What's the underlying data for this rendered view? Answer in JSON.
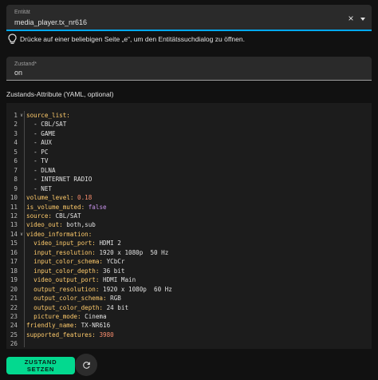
{
  "entity_field": {
    "label": "Entität",
    "value": "media_player.tx_nr616",
    "clear_glyph": "×"
  },
  "hint": {
    "icon": "lightbulb-icon",
    "text": "Drücke auf einer beliebigen Seite „e“, um den Entitätssuchdialog zu öffnen."
  },
  "state_field": {
    "label": "Zustand*",
    "value": "on"
  },
  "attributes_label": "Zustands-Attribute (YAML, optional)",
  "editor": {
    "lines": [
      {
        "n": "1",
        "fold": true,
        "tokens": [
          {
            "t": "source_list:",
            "c": "k"
          }
        ]
      },
      {
        "n": "2",
        "tokens": [
          {
            "t": "  - CBL/SAT",
            "c": "s"
          }
        ]
      },
      {
        "n": "3",
        "tokens": [
          {
            "t": "  - GAME",
            "c": "s"
          }
        ]
      },
      {
        "n": "4",
        "tokens": [
          {
            "t": "  - AUX",
            "c": "s"
          }
        ]
      },
      {
        "n": "5",
        "tokens": [
          {
            "t": "  - PC",
            "c": "s"
          }
        ]
      },
      {
        "n": "6",
        "tokens": [
          {
            "t": "  - TV",
            "c": "s"
          }
        ]
      },
      {
        "n": "7",
        "tokens": [
          {
            "t": "  - DLNA",
            "c": "s"
          }
        ]
      },
      {
        "n": "8",
        "tokens": [
          {
            "t": "  - INTERNET RADIO",
            "c": "s"
          }
        ]
      },
      {
        "n": "9",
        "tokens": [
          {
            "t": "  - NET",
            "c": "s"
          }
        ]
      },
      {
        "n": "10",
        "tokens": [
          {
            "t": "volume_level:",
            "c": "k"
          },
          {
            "t": " 0.18",
            "c": "n"
          }
        ]
      },
      {
        "n": "11",
        "tokens": [
          {
            "t": "is_volume_muted:",
            "c": "k"
          },
          {
            "t": " false",
            "c": "b"
          }
        ]
      },
      {
        "n": "12",
        "tokens": [
          {
            "t": "source:",
            "c": "k"
          },
          {
            "t": " CBL/SAT",
            "c": "s"
          }
        ]
      },
      {
        "n": "13",
        "tokens": [
          {
            "t": "video_out:",
            "c": "k"
          },
          {
            "t": " both,sub",
            "c": "s"
          }
        ]
      },
      {
        "n": "14",
        "fold": true,
        "tokens": [
          {
            "t": "video_information:",
            "c": "k"
          }
        ]
      },
      {
        "n": "15",
        "tokens": [
          {
            "t": "  video_input_port:",
            "c": "k"
          },
          {
            "t": " HDMI 2",
            "c": "s"
          }
        ]
      },
      {
        "n": "16",
        "tokens": [
          {
            "t": "  input_resolution:",
            "c": "k"
          },
          {
            "t": " 1920 x 1080p  50 Hz",
            "c": "s"
          }
        ]
      },
      {
        "n": "17",
        "tokens": [
          {
            "t": "  input_color_schema:",
            "c": "k"
          },
          {
            "t": " YCbCr",
            "c": "s"
          }
        ]
      },
      {
        "n": "18",
        "tokens": [
          {
            "t": "  input_color_depth:",
            "c": "k"
          },
          {
            "t": " 36 bit",
            "c": "s"
          }
        ]
      },
      {
        "n": "19",
        "tokens": [
          {
            "t": "  video_output_port:",
            "c": "k"
          },
          {
            "t": " HDMI Main",
            "c": "s"
          }
        ]
      },
      {
        "n": "20",
        "tokens": [
          {
            "t": "  output_resolution:",
            "c": "k"
          },
          {
            "t": " 1920 x 1080p  60 Hz",
            "c": "s"
          }
        ]
      },
      {
        "n": "21",
        "tokens": [
          {
            "t": "  output_color_schema:",
            "c": "k"
          },
          {
            "t": " RGB",
            "c": "s"
          }
        ]
      },
      {
        "n": "22",
        "tokens": [
          {
            "t": "  output_color_depth:",
            "c": "k"
          },
          {
            "t": " 24 bit",
            "c": "s"
          }
        ]
      },
      {
        "n": "23",
        "tokens": [
          {
            "t": "  picture_mode:",
            "c": "k"
          },
          {
            "t": " Cinema",
            "c": "s"
          }
        ]
      },
      {
        "n": "24",
        "tokens": [
          {
            "t": "friendly_name:",
            "c": "k"
          },
          {
            "t": " TX-NR616",
            "c": "s"
          }
        ]
      },
      {
        "n": "25",
        "tokens": [
          {
            "t": "supported_features:",
            "c": "k"
          },
          {
            "t": " 3980",
            "c": "n"
          }
        ]
      },
      {
        "n": "26",
        "tokens": []
      }
    ],
    "fold_glyph": "∨"
  },
  "actions": {
    "submit_label": "ZUSTAND SETZEN",
    "refresh_icon": "refresh-icon"
  },
  "colors": {
    "accent": "#03a9f4",
    "button": "#03d98f",
    "key": "#ffcb6b",
    "number": "#f78c6c",
    "boolean": "#c792ea"
  }
}
